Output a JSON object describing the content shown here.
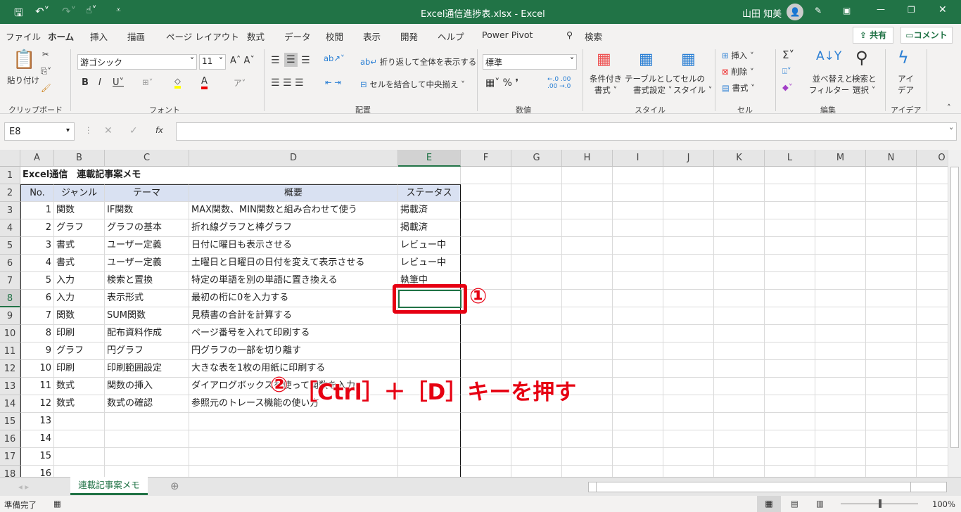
{
  "title": "Excel通信進捗表.xlsx  -  Excel",
  "user": "山田 知美",
  "menu": [
    "ファイル",
    "ホーム",
    "挿入",
    "描画",
    "ページ レイアウト",
    "数式",
    "データ",
    "校閲",
    "表示",
    "開発",
    "ヘルプ",
    "Power Pivot"
  ],
  "search": "検索",
  "share": "共有",
  "comment": "コメント",
  "ribbon": {
    "paste": "貼り付け",
    "clipboard": "クリップボード",
    "font_name": "游ゴシック",
    "font_size": "11",
    "font": "フォント",
    "wrap": "折り返して全体を表示する",
    "merge": "セルを結合して中央揃え",
    "alignment": "配置",
    "number_format": "標準",
    "number": "数値",
    "cond1": "条件付き",
    "cond2": "書式",
    "table1": "テーブルとして",
    "table2": "書式設定",
    "cellstyle1": "セルの",
    "cellstyle2": "スタイル",
    "styles": "スタイル",
    "insert": "挿入",
    "delete": "削除",
    "format": "書式",
    "cells": "セル",
    "sort1": "並べ替えと",
    "sort2": "フィルター",
    "find1": "検索と",
    "find2": "選択",
    "editing": "編集",
    "ideas1": "アイ",
    "ideas2": "デア",
    "ideas": "アイデア"
  },
  "namebox": "E8",
  "columns": [
    "A",
    "B",
    "C",
    "D",
    "E",
    "F",
    "G",
    "H",
    "I",
    "J",
    "K",
    "L",
    "M",
    "N",
    "O"
  ],
  "sheet": {
    "title": "Excel通信　連載記事案メモ",
    "headers": [
      "No.",
      "ジャンル",
      "テーマ",
      "概要",
      "ステータス"
    ],
    "rows": [
      [
        "1",
        "関数",
        "IF関数",
        "MAX関数、MIN関数と組み合わせて使う",
        "掲載済"
      ],
      [
        "2",
        "グラフ",
        "グラフの基本",
        "折れ線グラフと棒グラフ",
        "掲載済"
      ],
      [
        "3",
        "書式",
        "ユーザー定義",
        "日付に曜日も表示させる",
        "レビュー中"
      ],
      [
        "4",
        "書式",
        "ユーザー定義",
        "土曜日と日曜日の日付を変えて表示させる",
        "レビュー中"
      ],
      [
        "5",
        "入力",
        "検索と置換",
        "特定の単語を別の単語に置き換える",
        "執筆中"
      ],
      [
        "6",
        "入力",
        "表示形式",
        "最初の桁に0を入力する",
        ""
      ],
      [
        "7",
        "関数",
        "SUM関数",
        "見積書の合計を計算する",
        ""
      ],
      [
        "8",
        "印刷",
        "配布資料作成",
        "ページ番号を入れて印刷する",
        ""
      ],
      [
        "9",
        "グラフ",
        "円グラフ",
        "円グラフの一部を切り離す",
        ""
      ],
      [
        "10",
        "印刷",
        "印刷範囲設定",
        "大きな表を1枚の用紙に印刷する",
        ""
      ],
      [
        "11",
        "数式",
        "関数の挿入",
        "ダイアログボックスを使って関数を入力",
        ""
      ],
      [
        "12",
        "数式",
        "数式の確認",
        "参照元のトレース機能の使い方",
        ""
      ],
      [
        "13",
        "",
        "",
        "",
        ""
      ],
      [
        "14",
        "",
        "",
        "",
        ""
      ],
      [
        "15",
        "",
        "",
        "",
        ""
      ],
      [
        "16",
        "",
        "",
        "",
        ""
      ]
    ]
  },
  "annotations": {
    "step1": "①",
    "step2": "②",
    "step2_text": "［Ctrl］＋［D］キーを押す"
  },
  "sheet_tab": "連載記事案メモ",
  "status": "準備完了",
  "zoom": "100%"
}
